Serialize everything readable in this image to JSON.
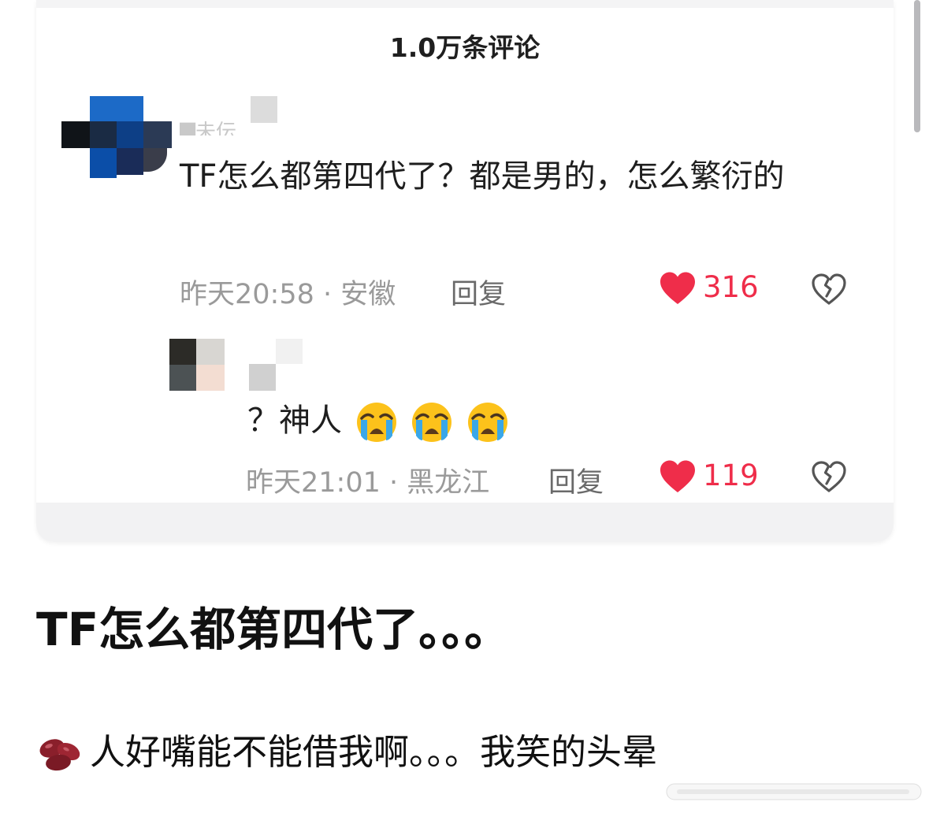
{
  "comments_header": {
    "count_label": "1.0万条评论"
  },
  "comments": [
    {
      "username": "▇未伝",
      "text": "TF怎么都第四代了？都是男的，怎么繁衍的",
      "time": "昨天20:58",
      "location": "安徽",
      "reply_label": "回复",
      "likes": "316"
    },
    {
      "username": "",
      "text": "？神人",
      "emoji": [
        "loudly-crying-face",
        "loudly-crying-face",
        "loudly-crying-face"
      ],
      "time": "昨天21:01",
      "location": "黑龙江",
      "reply_label": "回复",
      "likes": "119"
    }
  ],
  "meta_separator": " · ",
  "post": {
    "headline": "TF怎么都第四代了。。。",
    "body": "人好嘴能不能借我啊。。。我笑的头晕",
    "body_icon": "beans-emoji"
  },
  "colors": {
    "like_red": "#ef2d4a",
    "meta_gray": "#9a9a9a",
    "card_bottom": "#f2f2f3"
  }
}
